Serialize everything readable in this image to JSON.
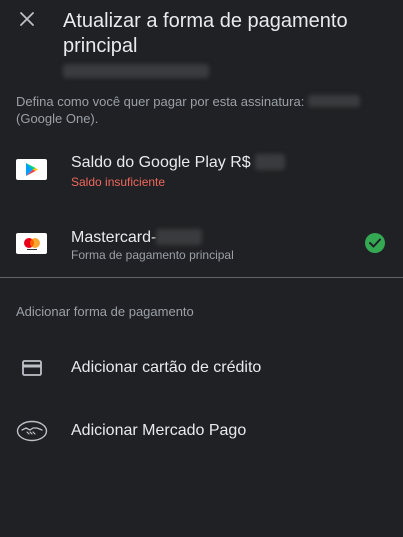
{
  "header": {
    "close_icon": "close-icon",
    "title": "Atualizar a forma de pagamento principal"
  },
  "description": {
    "text": "Defina como você quer pagar por esta assinatura:",
    "suffix": "(Google One)."
  },
  "payment_methods": [
    {
      "icon": "google-play-icon",
      "title": "Saldo do Google Play R$",
      "subtitle": "Saldo insuficiente",
      "subtitle_status": "error",
      "selected": false
    },
    {
      "icon": "mastercard-icon",
      "title": "Mastercard-",
      "subtitle": "Forma de pagamento principal",
      "selected": true
    }
  ],
  "add_section": {
    "header": "Adicionar forma de pagamento",
    "items": [
      {
        "icon": "credit-card-icon",
        "label": "Adicionar cartão de crédito"
      },
      {
        "icon": "handshake-icon",
        "label": "Adicionar Mercado Pago"
      }
    ]
  },
  "colors": {
    "background": "#202124",
    "text_primary": "#e8eaed",
    "text_secondary": "#9aa0a6",
    "error": "#ee675c",
    "selected_check": "#34a853",
    "divider": "#5f6368"
  }
}
